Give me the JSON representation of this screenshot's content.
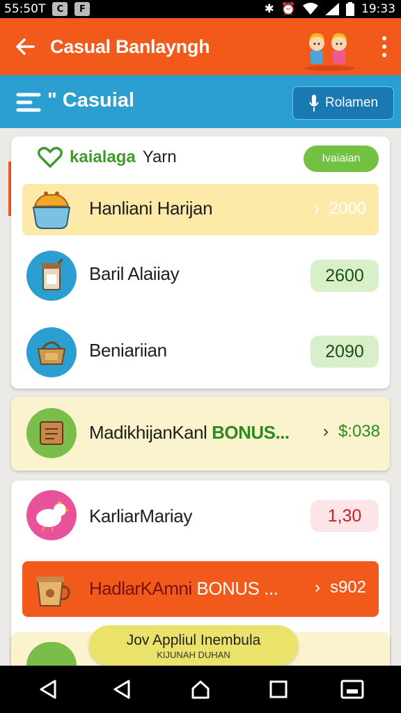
{
  "status_bar": {
    "left_text": "55:50T",
    "time": "19:33"
  },
  "app_bar": {
    "title": "Casual Banlayngh"
  },
  "sub_bar": {
    "title": "\" Casuial",
    "button_label": "Rolamen"
  },
  "card1": {
    "header_green": "kaialaga",
    "header_dark": "Yarn",
    "badge": "Ivaiaian",
    "rows": [
      {
        "name": "Hanliani Harijan",
        "value": "2000",
        "highlighted": true
      },
      {
        "name": "Baril Alaiiay",
        "value": "2600"
      },
      {
        "name": "Beniariian",
        "value": "2090"
      }
    ]
  },
  "card2": {
    "name": "MadikhijanKanl",
    "bonus": "BONUS...",
    "value": "$:038"
  },
  "card3": {
    "row": {
      "name": "KarliarMariay",
      "value": "1,30"
    },
    "bonus_row": {
      "name": "HadlarKAmni",
      "bonus": "BONUS ...",
      "value": "s902"
    }
  },
  "toast": {
    "line1": "Jov Appliul Inembula",
    "line2": "KIJUNAH DUHAN"
  },
  "colors": {
    "primary": "#f25a1c",
    "secondary": "#2a9fd0",
    "positive": "#72c141",
    "negative": "#c4232c",
    "bonus_text": "#2e8a1f"
  }
}
